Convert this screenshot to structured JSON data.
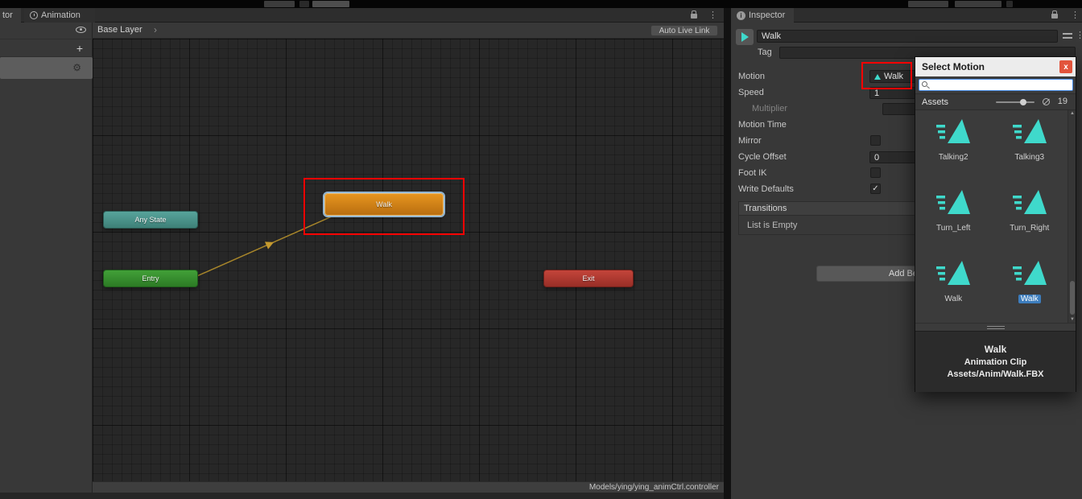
{
  "icons": {
    "kebab": "⋮",
    "plus": "+",
    "gear": "⚙",
    "chevron": "›",
    "check": "✓",
    "scroll_up": "▲",
    "scroll_down": "▼",
    "info": "i"
  },
  "colors": {
    "annotation_red": "#ff0000",
    "walk_node_orange": "#d4821c",
    "entry_green": "#2f8a28",
    "exit_red": "#b0382f",
    "any_state_teal": "#4a968e",
    "selection_blue": "#3d7dbd",
    "clip_icon_teal": "#3fd9cb"
  },
  "animator": {
    "partial_tab": "tor",
    "animation_tab": "Animation",
    "breadcrumb": "Base Layer",
    "auto_live_link": "Auto Live Link",
    "status_path": "Models/ying/ying_animCtrl.controller",
    "nodes": {
      "any_state": "Any State",
      "walk": "Walk",
      "entry": "Entry",
      "exit": "Exit"
    }
  },
  "inspector": {
    "tab": "Inspector",
    "state_name": "Walk",
    "tag_label": "Tag",
    "tag_value": "",
    "properties": {
      "motion": {
        "label": "Motion",
        "value": "Walk"
      },
      "speed": {
        "label": "Speed",
        "value": "1"
      },
      "multiplier": {
        "label": "Multiplier",
        "value": ""
      },
      "motion_time": {
        "label": "Motion Time",
        "value": ""
      },
      "mirror": {
        "label": "Mirror",
        "checked": false
      },
      "cycle_offset": {
        "label": "Cycle Offset",
        "value": "0"
      },
      "foot_ik": {
        "label": "Foot IK",
        "checked": false
      },
      "write_defaults": {
        "label": "Write Defaults",
        "checked": true
      }
    },
    "transitions": {
      "header": "Transitions",
      "empty": "List is Empty"
    },
    "add_behaviour": "Add Behaviour"
  },
  "select_motion": {
    "title": "Select Motion",
    "close_label": "x",
    "search_placeholder": "",
    "tab_assets": "Assets",
    "count": "19",
    "items": [
      {
        "name": "Talking2",
        "selected": false
      },
      {
        "name": "Talking3",
        "selected": false
      },
      {
        "name": "Turn_Left",
        "selected": false
      },
      {
        "name": "Turn_Right",
        "selected": false
      },
      {
        "name": "Walk",
        "selected": false
      },
      {
        "name": "Walk",
        "selected": true
      }
    ],
    "footer": {
      "name": "Walk",
      "type": "Animation Clip",
      "path": "Assets/Anim/Walk.FBX"
    }
  }
}
